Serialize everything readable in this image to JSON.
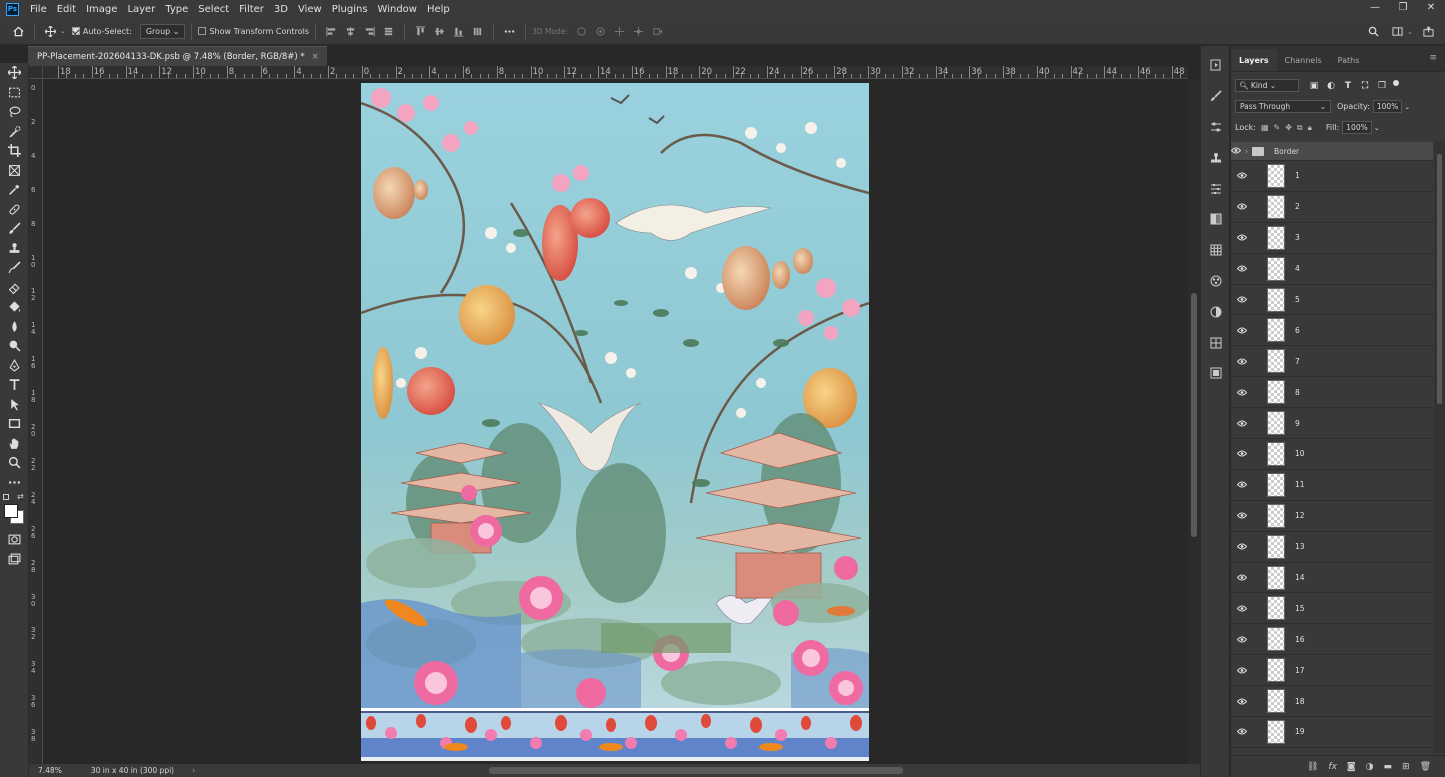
{
  "menu": {
    "logo": "Ps",
    "items": [
      "File",
      "Edit",
      "Image",
      "Layer",
      "Type",
      "Select",
      "Filter",
      "3D",
      "View",
      "Plugins",
      "Window",
      "Help"
    ]
  },
  "window_controls": [
    "—",
    "❐",
    "✕"
  ],
  "options": {
    "auto_select_label": "Auto-Select:",
    "auto_select_value": "Group",
    "transform_label": "Show Transform Controls",
    "mode3d_label": "3D Mode:"
  },
  "document": {
    "tab_title": "PP-Placement-202604133-DK.psb @ 7.48% (Border, RGB/8#) *",
    "close": "×"
  },
  "rulers": {
    "h_labels": [
      "18",
      "16",
      "14",
      "12",
      "10",
      "8",
      "6",
      "4",
      "2",
      "0",
      "2",
      "4",
      "6",
      "8",
      "10",
      "12",
      "14",
      "16",
      "18",
      "20",
      "22",
      "24",
      "26",
      "28",
      "30",
      "32",
      "34",
      "36",
      "38",
      "40",
      "42",
      "44",
      "46",
      "48"
    ],
    "v_labels": [
      "0",
      "2",
      "4",
      "6",
      "8",
      "10",
      "12",
      "14",
      "16",
      "18",
      "20",
      "22",
      "24",
      "26",
      "28",
      "30",
      "32",
      "34",
      "36",
      "38"
    ]
  },
  "status": {
    "zoom": "7.48%",
    "doc_info": "30 in x 40 in (300 ppi)",
    "arrow": "›"
  },
  "layers_panel": {
    "tabs": [
      "Layers",
      "Channels",
      "Paths"
    ],
    "filter_kind": "Kind",
    "blend_mode": "Pass Through",
    "opacity_label": "Opacity:",
    "opacity_value": "100%",
    "lock_label": "Lock:",
    "fill_label": "Fill:",
    "fill_value": "100%",
    "group_name": "Border",
    "layers": [
      "1",
      "2",
      "3",
      "4",
      "5",
      "6",
      "7",
      "8",
      "9",
      "10",
      "11",
      "12",
      "13",
      "14",
      "15",
      "16",
      "17",
      "18",
      "19"
    ]
  },
  "footer_icons": [
    "link-icon",
    "fx-icon",
    "mask-icon",
    "adjustment-icon",
    "folder-icon",
    "new-layer-icon",
    "trash-icon"
  ],
  "footer_fx": "fx"
}
